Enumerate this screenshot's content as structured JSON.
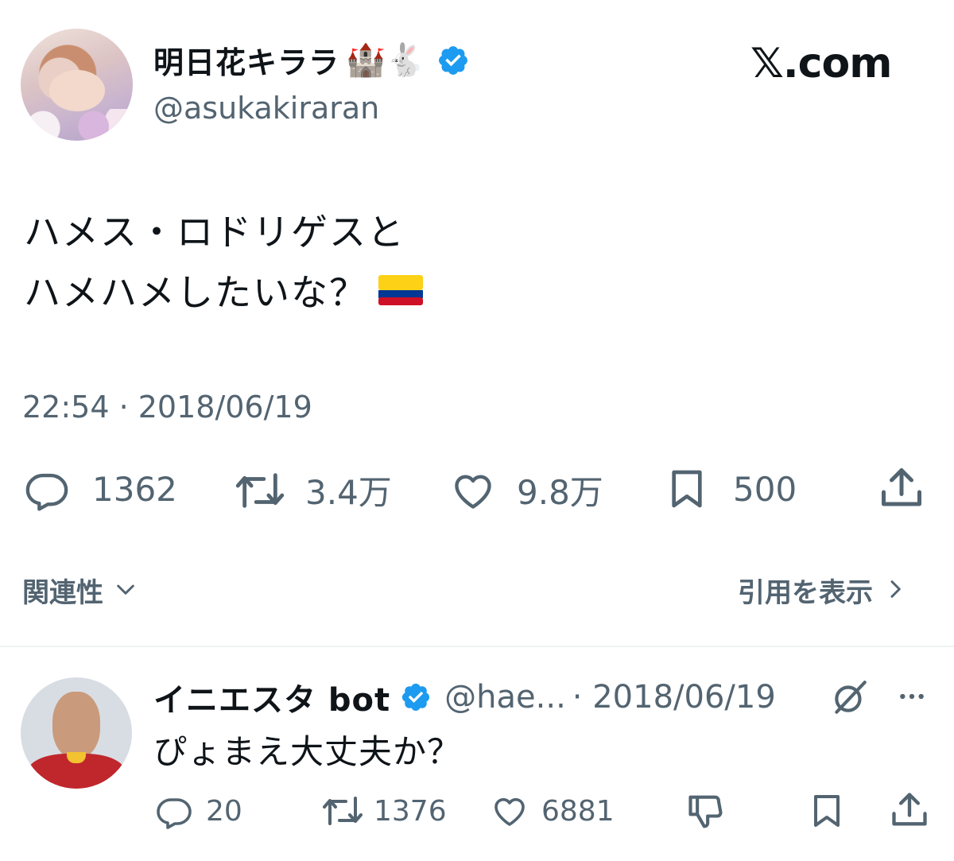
{
  "tweet": {
    "author_name": "明日花キララ",
    "author_emojis": "🏰🐇",
    "handle": "@asukakiraran",
    "brand": "𝕏.com",
    "text_line1": "ハメス・ロドリゲスと",
    "text_line2": "ハメハメしたいな？",
    "text_emoji": "🇨🇴",
    "timestamp": "22:54 · 2018/06/19",
    "actions": {
      "replies": "1362",
      "retweets": "3.4万",
      "likes": "9.8万",
      "bookmarks": "500"
    }
  },
  "sort": {
    "label": "関連性",
    "quotes_link": "引用を表示"
  },
  "reply": {
    "author_name": "イニエスタ bot",
    "handle": "@hae...",
    "date": "· 2018/06/19",
    "text": "ぴょまえ大丈夫か？",
    "actions": {
      "replies": "20",
      "retweets": "1376",
      "likes": "6881"
    }
  },
  "colors": {
    "verified": "#1d9bf0",
    "secondary_text": "#536471",
    "text": "#0f1419",
    "colombia_flag": [
      "#fcd116",
      "#003893",
      "#ce1126"
    ]
  },
  "icons": [
    "verified-badge-icon",
    "reply-icon",
    "retweet-icon",
    "like-icon",
    "bookmark-icon",
    "share-icon",
    "chevron-down-icon",
    "chevron-right-icon",
    "grok-icon",
    "more-icon",
    "dislike-icon"
  ]
}
